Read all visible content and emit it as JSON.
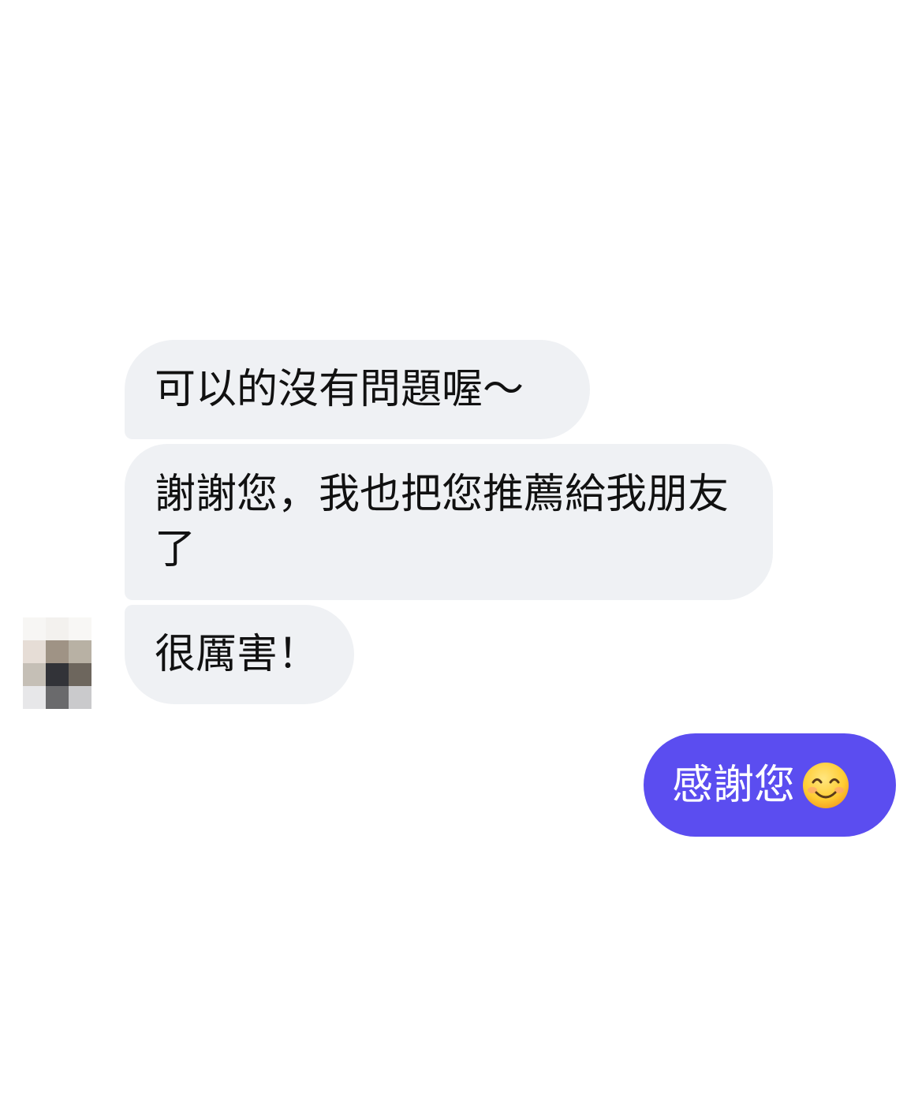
{
  "conversation": {
    "incoming": [
      {
        "text": "可以的沒有問題喔～"
      },
      {
        "text": "謝謝您，我也把您推薦給我朋友了"
      },
      {
        "text": "很厲害！"
      }
    ],
    "outgoing": [
      {
        "text": "感謝您",
        "emoji": "smiling-face-with-smiling-eyes"
      }
    ]
  },
  "colors": {
    "incoming_bubble": "#eff1f4",
    "outgoing_bubble": "#5b4df0",
    "incoming_text": "#111111",
    "outgoing_text": "#ffffff",
    "background": "#ffffff"
  },
  "avatar": {
    "style": "pixelated"
  }
}
